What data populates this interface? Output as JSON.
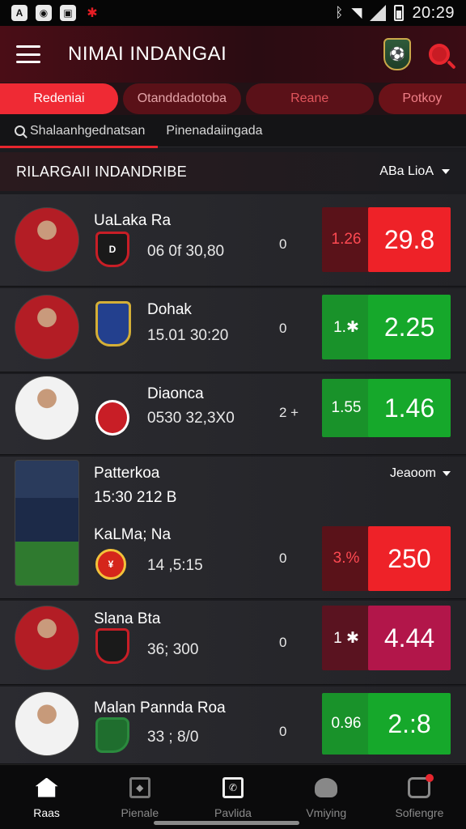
{
  "status_bar": {
    "time": "20:29",
    "left_icons": [
      "app-icon-a",
      "app-icon-b",
      "app-icon-c",
      "app-icon-d"
    ],
    "right_icons": [
      "bluetooth-icon",
      "wifi-icon",
      "signal-icon",
      "battery-icon"
    ]
  },
  "app_bar": {
    "title": "NIMAI INDANGAI",
    "icons": [
      "menu-icon",
      "team-badge-icon",
      "search-icon"
    ]
  },
  "tabs": [
    "Redeniai",
    "Otanddadotoba",
    "Reane",
    "Potkoy"
  ],
  "subtabs": [
    "Shalaanhgednatsan",
    "Pinenadaiingada"
  ],
  "section": {
    "title": "RILARGAII INDANDRIBE",
    "filter_label": "ABa LioA"
  },
  "matches": [
    {
      "team": "UaLaka Ra",
      "time": "06 0f 30,80",
      "score": "0",
      "odd_small": "1.26",
      "odd_big": "29.8",
      "color": "red",
      "crest_text": "D"
    },
    {
      "team": "Dohak",
      "time": "15.01 30:20",
      "score": "0",
      "odd_small": "1.✱",
      "odd_big": "2.25",
      "color": "green",
      "crest_text": ""
    },
    {
      "team": "Diaonca",
      "time": "0530 32,3X0",
      "score": "2 +",
      "odd_small": "1.55",
      "odd_big": "1.46",
      "color": "green",
      "crest_text": ""
    },
    {
      "team": "KaLMa; Na",
      "time": "14 ,5:15",
      "score": "0",
      "odd_small": "3.%",
      "odd_big": "250",
      "color": "red",
      "crest_text": "¥",
      "group_title": "Patterkoa",
      "group_time": "15:30 212 B",
      "group_filter": "Jeaoom"
    },
    {
      "team": "Slana Bta",
      "time": "36; 300",
      "score": "0",
      "odd_small": "1 ✱",
      "odd_big": "4.44",
      "color": "magenta",
      "crest_text": ""
    },
    {
      "team": "Malan Pannda Roa",
      "time": "33 ; 8/0",
      "score": "0",
      "odd_small": "0.96",
      "odd_big": "2.:8",
      "color": "green",
      "crest_text": ""
    }
  ],
  "bottom_nav": [
    {
      "label": "Raas",
      "icon": "home-icon",
      "active": true
    },
    {
      "label": "Pienale",
      "icon": "card-icon",
      "active": false
    },
    {
      "label": "Pavlida",
      "icon": "phone-icon",
      "active": false
    },
    {
      "label": "Vmiying",
      "icon": "bell-icon",
      "active": false
    },
    {
      "label": "Sofiengre",
      "icon": "settings-icon",
      "active": false
    }
  ]
}
